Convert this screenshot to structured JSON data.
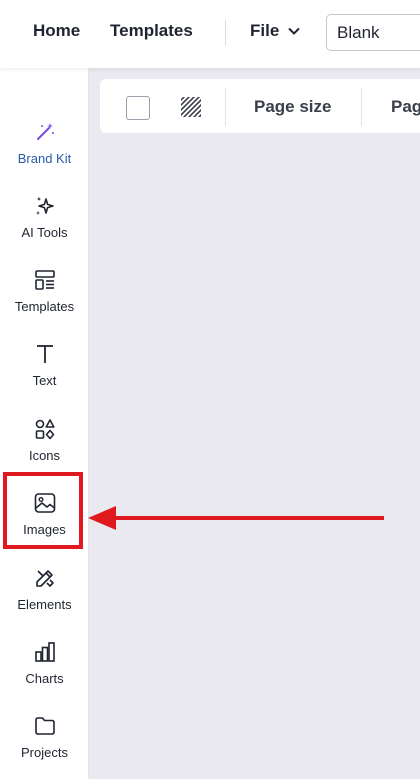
{
  "topbar": {
    "home": "Home",
    "templates": "Templates",
    "file": "File",
    "document_name": "Blank"
  },
  "sidebar": {
    "items": [
      {
        "label": "Brand Kit",
        "icon": "magic-wand-icon",
        "active": true
      },
      {
        "label": "AI Tools",
        "icon": "sparkles-icon"
      },
      {
        "label": "Templates",
        "icon": "templates-icon"
      },
      {
        "label": "Text",
        "icon": "text-icon"
      },
      {
        "label": "Icons",
        "icon": "shapes-icon"
      },
      {
        "label": "Images",
        "icon": "image-icon"
      },
      {
        "label": "Elements",
        "icon": "elements-icon"
      },
      {
        "label": "Charts",
        "icon": "bar-chart-icon"
      },
      {
        "label": "Projects",
        "icon": "folder-icon"
      }
    ]
  },
  "toolbar": {
    "page_size": "Page size",
    "page_partial": "Pag"
  },
  "annotation": {
    "highlight_color": "#e0191f",
    "target": "Images"
  },
  "colors": {
    "active": "#2a5ba8",
    "accent_purple": "#7b4ce0",
    "canvas_bg": "#e9e9ef"
  }
}
